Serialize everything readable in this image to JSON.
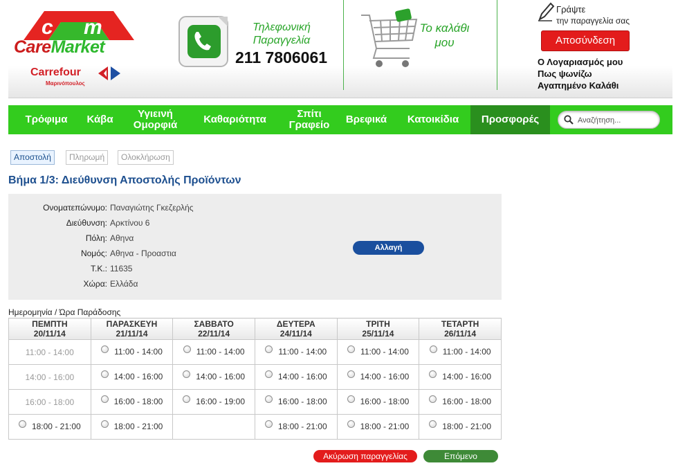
{
  "header": {
    "logo": {
      "letters": "c m",
      "brand_prefix": "Care",
      "brand_suffix": "Market",
      "partner": "Carrefour",
      "partner_sub": "Μαρινόπουλος"
    },
    "phone": {
      "label": "Τηλεφωνική Παραγγελία",
      "number": "211 7806061"
    },
    "cart": {
      "label": "Το καλάθι μου"
    },
    "write": {
      "title": "Γράψτε",
      "subtitle": "την παραγγελία σας"
    },
    "logout_label": "Αποσύνδεση",
    "links": [
      "Ο Λογαριασμός μου",
      "Πως ψωνίζω",
      "Αγαπημένο Καλάθι"
    ]
  },
  "nav": {
    "items": [
      "Τρόφιμα",
      "Κάβα",
      "Υγιεινή Ομορφιά",
      "Καθαριότητα",
      "Σπίτι Γραφείο",
      "Βρεφικά",
      "Κατοικίδια",
      "Προσφορές"
    ],
    "active": "Προσφορές",
    "search_placeholder": "Αναζήτηση..."
  },
  "steps": [
    "Αποστολή",
    "Πληρωμή",
    "Ολοκλήρωση"
  ],
  "page_title": "Βήμα 1/3: Διεύθυνση Αποστολής Προϊόντων",
  "address": {
    "rows": [
      {
        "label": "Ονοματεπώνυμο:",
        "value": "Παναγιώτης Γκεζερλής"
      },
      {
        "label": "Διεύθυνση:",
        "value": "Αρκτίνου 6"
      },
      {
        "label": "Πόλη:",
        "value": "Αθηνα"
      },
      {
        "label": "Νομός:",
        "value": "Αθηνα - Προαστια"
      },
      {
        "label": "Τ.Κ.:",
        "value": "11635"
      },
      {
        "label": "Χώρα:",
        "value": "Ελλάδα"
      }
    ],
    "change_label": "Αλλαγή"
  },
  "delivery": {
    "label": "Ημερομηνία / Ώρα Παράδοσης",
    "days": [
      {
        "day": "ΠΕΜΠΤΗ",
        "date": "20/11/14"
      },
      {
        "day": "ΠΑΡΑΣΚΕΥΗ",
        "date": "21/11/14"
      },
      {
        "day": "ΣΑΒΒΑΤΟ",
        "date": "22/11/14"
      },
      {
        "day": "ΔΕΥΤΕΡΑ",
        "date": "24/11/14"
      },
      {
        "day": "ΤΡΙΤΗ",
        "date": "25/11/14"
      },
      {
        "day": "ΤΕΤΑΡΤΗ",
        "date": "26/11/14"
      }
    ],
    "rows": [
      [
        {
          "time": "11:00 - 14:00",
          "state": "disabled"
        },
        {
          "time": "11:00 - 14:00",
          "state": "open"
        },
        {
          "time": "11:00 - 14:00",
          "state": "open"
        },
        {
          "time": "11:00 - 14:00",
          "state": "open"
        },
        {
          "time": "11:00 - 14:00",
          "state": "open"
        },
        {
          "time": "11:00 - 14:00",
          "state": "open"
        }
      ],
      [
        {
          "time": "14:00 - 16:00",
          "state": "disabled"
        },
        {
          "time": "14:00 - 16:00",
          "state": "open"
        },
        {
          "time": "14:00 - 16:00",
          "state": "open"
        },
        {
          "time": "14:00 - 16:00",
          "state": "open"
        },
        {
          "time": "14:00 - 16:00",
          "state": "open"
        },
        {
          "time": "14:00 - 16:00",
          "state": "open"
        }
      ],
      [
        {
          "time": "16:00 - 18:00",
          "state": "disabled"
        },
        {
          "time": "16:00 - 18:00",
          "state": "open"
        },
        {
          "time": "16:00 - 19:00",
          "state": "open"
        },
        {
          "time": "16:00 - 18:00",
          "state": "open"
        },
        {
          "time": "16:00 - 18:00",
          "state": "open"
        },
        {
          "time": "16:00 - 18:00",
          "state": "open"
        }
      ],
      [
        {
          "time": "18:00 - 21:00",
          "state": "open"
        },
        {
          "time": "18:00 - 21:00",
          "state": "open"
        },
        {
          "time": "",
          "state": "empty"
        },
        {
          "time": "18:00 - 21:00",
          "state": "open"
        },
        {
          "time": "18:00 - 21:00",
          "state": "open"
        },
        {
          "time": "18:00 - 21:00",
          "state": "open"
        }
      ]
    ]
  },
  "actions": {
    "cancel_label": "Ακύρωση παραγγελίας",
    "next_label": "Επόμενο"
  },
  "colors": {
    "nav_green": "#33cc1e",
    "nav_active": "#2a8f1e",
    "title_blue": "#1d4f8f",
    "logout_red": "#e31c1c",
    "next_green": "#3e8a37"
  }
}
